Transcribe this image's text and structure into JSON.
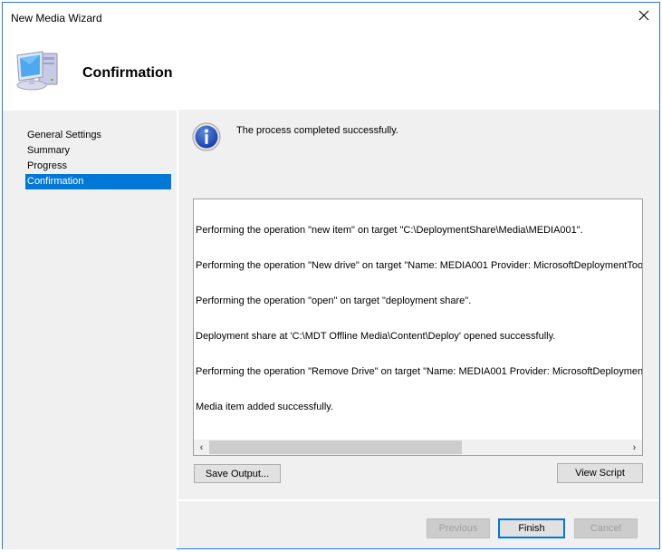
{
  "window": {
    "title": "New Media Wizard",
    "close_icon": "close-icon"
  },
  "header": {
    "icon": "computer-icon",
    "title": "Confirmation"
  },
  "sidebar": {
    "items": [
      {
        "label": "General Settings",
        "active": false
      },
      {
        "label": "Summary",
        "active": false
      },
      {
        "label": "Progress",
        "active": false
      },
      {
        "label": "Confirmation",
        "active": true
      }
    ]
  },
  "content": {
    "status_icon": "info-icon",
    "status_text": "The process completed successfully.",
    "output_lines": [
      "Performing the operation \"new item\" on target \"C:\\DeploymentShare\\Media\\MEDIA001\".",
      "Performing the operation \"New drive\" on target \"Name: MEDIA001 Provider: MicrosoftDeploymentToolki",
      "Performing the operation \"open\" on target \"deployment share\".",
      "Deployment share at 'C:\\MDT Offline Media\\Content\\Deploy' opened successfully.",
      "Performing the operation \"Remove Drive\" on target \"Name: MEDIA001 Provider: MicrosoftDeploymentTo",
      "Media item added successfully."
    ],
    "save_output_label": "Save Output...",
    "view_script_label": "View Script"
  },
  "footer": {
    "previous_label": "Previous",
    "finish_label": "Finish",
    "cancel_label": "Cancel"
  },
  "colors": {
    "accent": "#0078d7",
    "window_border": "#2b79d0",
    "panel_bg": "#f0f0f0"
  }
}
